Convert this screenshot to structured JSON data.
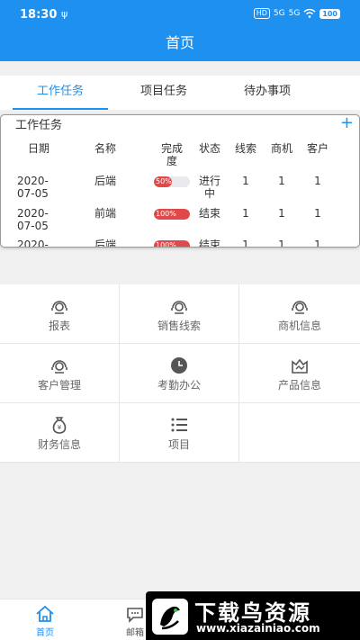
{
  "status": {
    "time": "18:30",
    "usb": "ψ",
    "icons": [
      "HD",
      "5G",
      "5G",
      "WiFi"
    ],
    "battery": "100"
  },
  "header": {
    "title": "首页"
  },
  "tabs": [
    {
      "label": "工作任务",
      "active": true
    },
    {
      "label": "项目任务",
      "active": false
    },
    {
      "label": "待办事项",
      "active": false
    }
  ],
  "task_card": {
    "title": "工作任务",
    "add_icon": "+",
    "columns": [
      "日期",
      "名称",
      "完成\n度",
      "状态",
      "线索",
      "商机",
      "客户"
    ],
    "rows": [
      {
        "date": "2020-\n07-05",
        "name": "后端",
        "progress": 0.5,
        "progress_label": "50%",
        "status": "进行\n中",
        "leads": "1",
        "opportunities": "1",
        "customers": "1"
      },
      {
        "date": "2020-\n07-05",
        "name": "前端",
        "progress": 1.0,
        "progress_label": "100%",
        "status": "结束",
        "leads": "1",
        "opportunities": "1",
        "customers": "1"
      },
      {
        "date": "2020-",
        "name": "后端",
        "progress": 1.0,
        "progress_label": "100%",
        "status": "结束",
        "leads": "1",
        "opportunities": "1",
        "customers": "1"
      }
    ]
  },
  "menu": [
    {
      "label": "报表",
      "icon": "headset-icon"
    },
    {
      "label": "销售线索",
      "icon": "headset-icon"
    },
    {
      "label": "商机信息",
      "icon": "headset-icon"
    },
    {
      "label": "客户管理",
      "icon": "headset-icon"
    },
    {
      "label": "考勤办公",
      "icon": "clock-icon"
    },
    {
      "label": "产品信息",
      "icon": "product-icon"
    },
    {
      "label": "财务信息",
      "icon": "money-bag-icon"
    },
    {
      "label": "项目",
      "icon": "list-icon"
    }
  ],
  "bottom_nav": [
    {
      "label": "首页",
      "icon": "home-icon",
      "active": true
    },
    {
      "label": "邮箱",
      "icon": "chat-icon",
      "active": false
    }
  ],
  "watermark": {
    "title": "下载鸟资源",
    "url": "www.xiazainiao.com"
  },
  "colors": {
    "primary": "#1e90f0",
    "progress": "#e0494a"
  }
}
